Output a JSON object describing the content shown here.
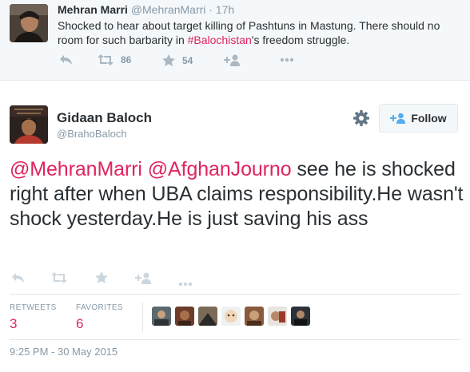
{
  "parent_tweet": {
    "name": "Mehran Marri",
    "handle": "@MehranMarri",
    "separator": "·",
    "time": "17h",
    "text_before": "Shocked to hear about target killing of Pashtuns in Mastung. There should no room for such barbarity in ",
    "hashtag": "#Balochistan",
    "text_after": "'s freedom struggle.",
    "retweets": "86",
    "favorites": "54"
  },
  "tweet": {
    "name": "Gidaan Baloch",
    "handle": "@BrahoBaloch",
    "follow_label": "Follow",
    "mention_1": "@MehranMarri",
    "mention_2": "@AfghanJourno",
    "text": " see he is shocked right after when UBA claims responsibility.He wasn't shock yesterday.He is just saving his ass",
    "stats": {
      "retweets_label": "RETWEETS",
      "retweets_value": "3",
      "favorites_label": "FAVORITES",
      "favorites_value": "6"
    },
    "timestamp": "9:25 PM - 30 May 2015"
  },
  "icons": [
    "reply-icon",
    "retweet-icon",
    "favorite-icon",
    "add-to-list-icon",
    "more-icon",
    "gear-icon"
  ],
  "colors": {
    "accent": "#e0245e",
    "muted": "#8899a6",
    "icon": "#ccd6dd"
  }
}
